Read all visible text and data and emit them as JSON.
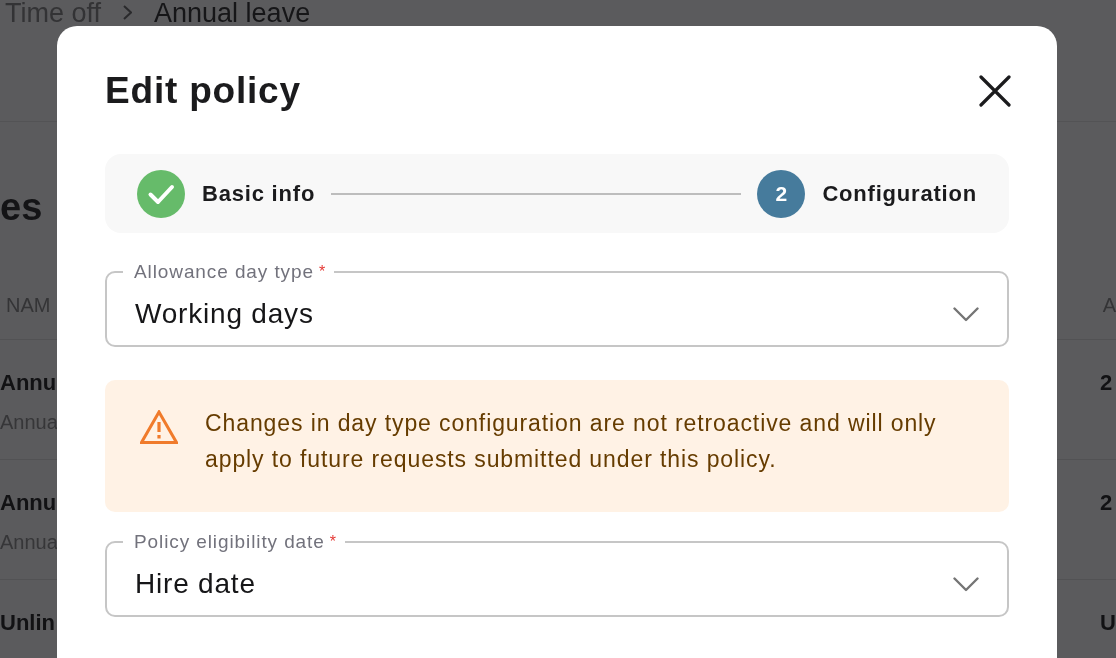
{
  "background_page": {
    "breadcrumb": [
      {
        "label": "Time off"
      },
      {
        "label": "Annual leave"
      }
    ],
    "heading": "es",
    "table": {
      "columns": [
        "NAM",
        "A"
      ],
      "rows": [
        {
          "title": "Annu",
          "subtitle": "Annua",
          "column_2": "2"
        },
        {
          "title": "Annu",
          "subtitle": "Annua",
          "column_2": "2"
        },
        {
          "title": "Unlin",
          "column_2": "U"
        }
      ]
    }
  },
  "modal": {
    "title": "Edit policy",
    "stepper": {
      "steps": [
        {
          "label": "Basic info",
          "completed": true,
          "selected": false
        },
        {
          "label": "Configuration",
          "number": "2",
          "completed": false,
          "selected": true
        }
      ]
    },
    "form": [
      {
        "kind": "select",
        "label": "Allowance day type",
        "required_mark": "*",
        "value": "Working days"
      },
      {
        "kind": "warning",
        "message": "Changes in day type configuration are not retroactive and will only apply to future requests submitted under this policy."
      },
      {
        "kind": "select",
        "label": "Policy eligibility date",
        "required_mark": "*",
        "value": "Hire date"
      }
    ]
  }
}
